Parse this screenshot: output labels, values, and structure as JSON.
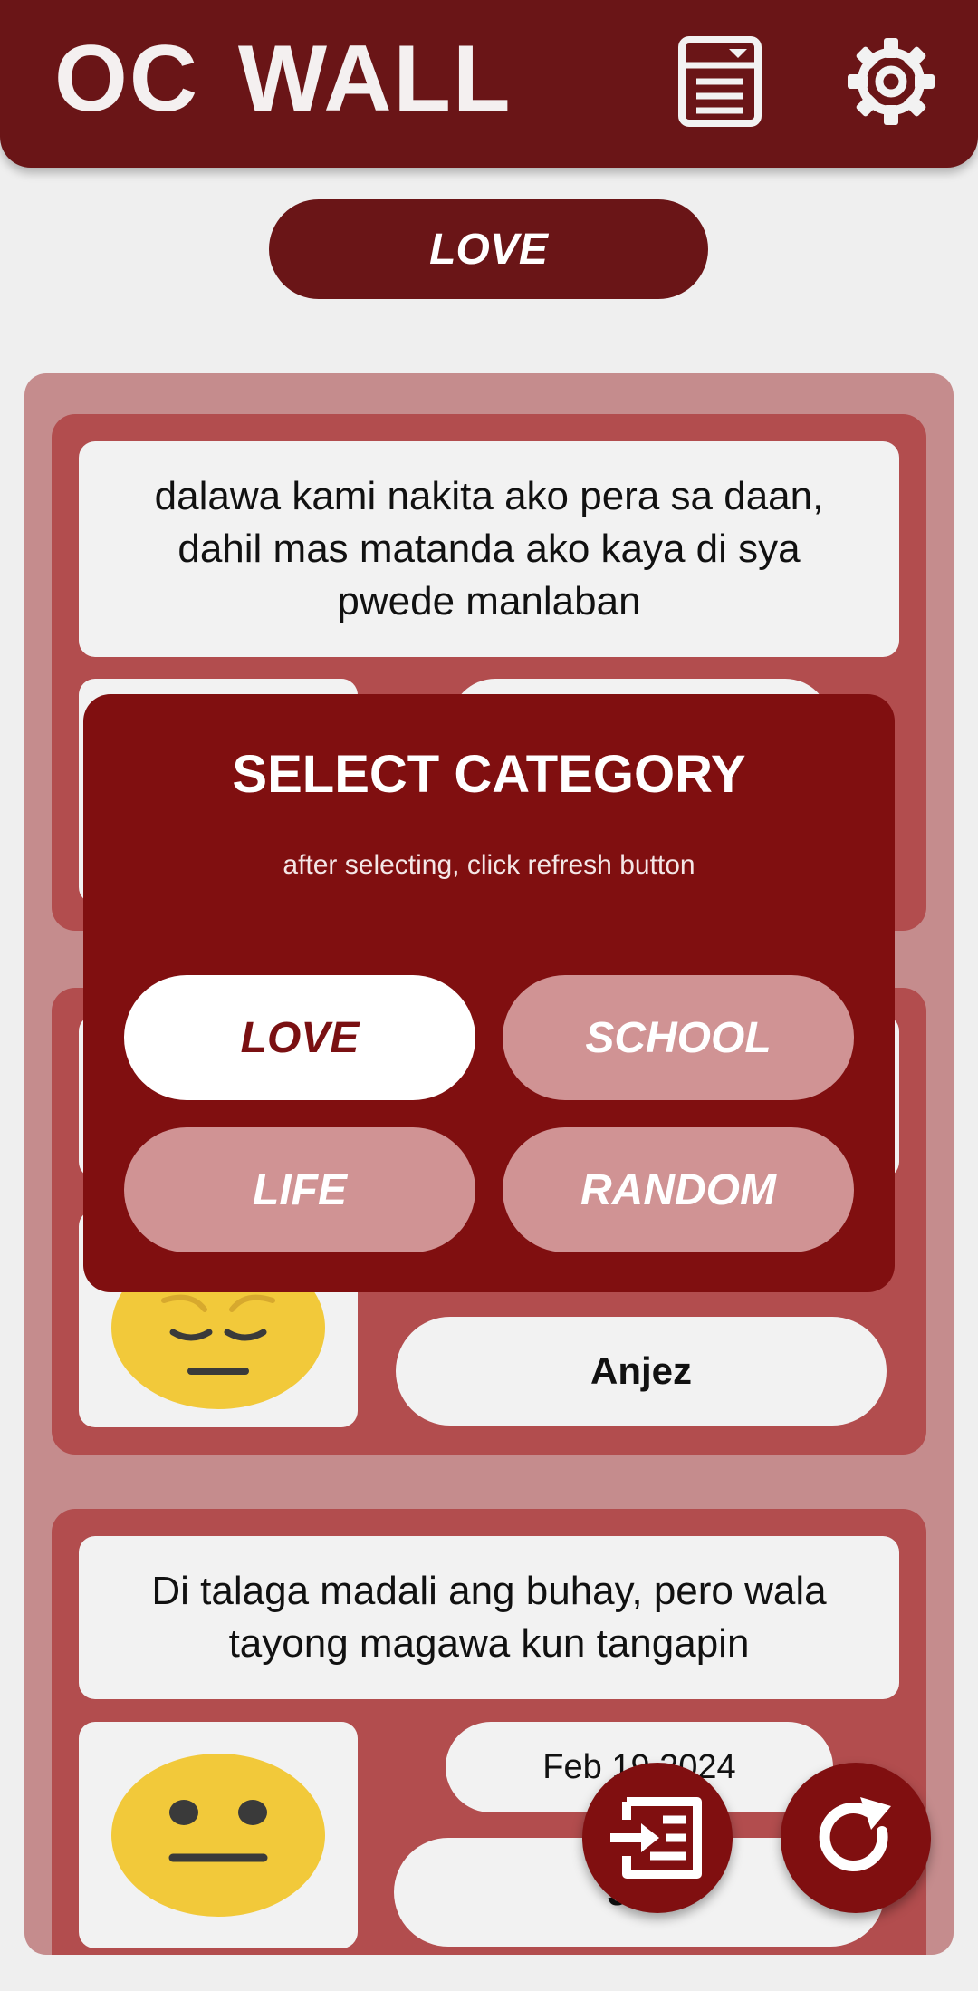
{
  "header": {
    "title": "OC WALL",
    "notes_icon": "notes-icon",
    "settings_icon": "gear-icon"
  },
  "category_button": {
    "label": "LOVE"
  },
  "posts": [
    {
      "message": "dalawa kami nakita ako pera sa daan, dahil mas matanda ako kaya di sya pwede manlaban",
      "emoji": "unknown",
      "date": "",
      "name": ""
    },
    {
      "message": "",
      "emoji": "pensive-face-emoji",
      "date": "",
      "name": "Anjez"
    },
    {
      "message": "Di talaga madali ang buhay, pero wala tayong magawa kun tangapin",
      "emoji": "neutral-face-emoji",
      "date": "Feb 19 2024",
      "name": "Ji..."
    }
  ],
  "modal": {
    "title": "SELECT CATEGORY",
    "subtitle": "after selecting, click refresh button",
    "options": [
      {
        "label": "LOVE",
        "selected": true
      },
      {
        "label": "SCHOOL",
        "selected": false
      },
      {
        "label": "LIFE",
        "selected": false
      },
      {
        "label": "RANDOM",
        "selected": false
      }
    ]
  },
  "fabs": {
    "post_icon": "post-message-icon",
    "refresh_icon": "refresh-icon"
  },
  "colors": {
    "primary": "#6a1517",
    "modal": "#800f10",
    "card": "#b24d4e",
    "feed": "#c58c8d",
    "option": "#d09394"
  }
}
